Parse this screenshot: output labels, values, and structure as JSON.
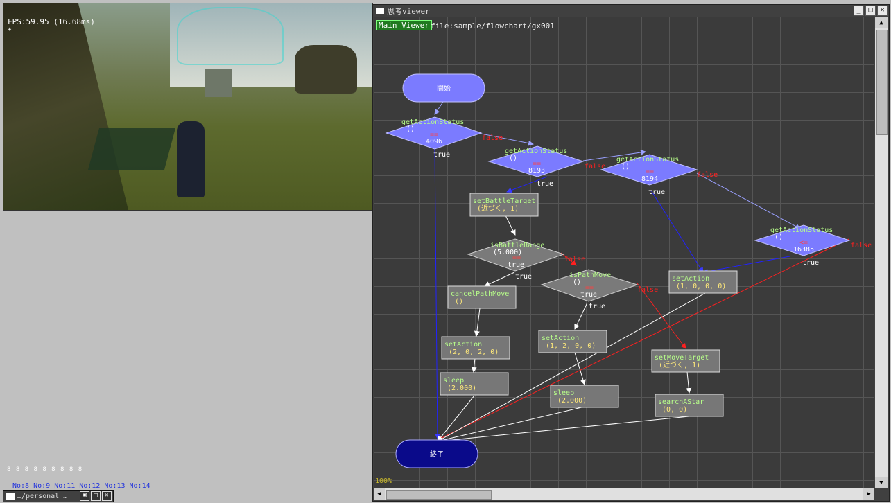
{
  "game": {
    "fps": "FPS:59.95 (16.68ms)",
    "fps_sub": "+"
  },
  "counters": [
    "No:8",
    "No:9",
    "No:11",
    "No:12",
    "No:13",
    "No:14"
  ],
  "dots": "8 8 8 8 8 8 8 8 8",
  "taskbar": {
    "title": "…/personal …"
  },
  "viewer": {
    "title": "思考viewer",
    "main_button": "Main Viewer",
    "file": "file:sample/flowchart/gx001",
    "zoom": "100%"
  },
  "flow": {
    "start": "開始",
    "end": "終了",
    "d1": [
      "getActionStatus",
      "()",
      "==",
      "4096"
    ],
    "d2": [
      "getActionStatus",
      "()",
      "==",
      "8193"
    ],
    "d3": [
      "getActionStatus",
      "()",
      "==",
      "8194"
    ],
    "d4": [
      "getActionStatus",
      "()",
      "<=",
      "16385"
    ],
    "d5": [
      "isBattleRange",
      "(5.000)",
      "==",
      "true"
    ],
    "d6": [
      "isPathMove",
      "()",
      "==",
      "true"
    ],
    "b1": [
      "setBattleTarget",
      "(近づく, 1)"
    ],
    "b2": [
      "cancelPathMove",
      "()"
    ],
    "b3": [
      "setAction",
      "(2, 0, 2, 0)"
    ],
    "b4": [
      "sleep",
      "(2.000)"
    ],
    "b5": [
      "setAction",
      "(1, 2, 0, 0)"
    ],
    "b6": [
      "sleep",
      "(2.000)"
    ],
    "b7": [
      "setAction",
      "(1, 0, 0, 0)"
    ],
    "b8": [
      "setMoveTarget",
      "(近づく, 1)"
    ],
    "b9": [
      "searchAStar",
      "(0, 0)"
    ],
    "true_label": "true",
    "false_label": "false"
  }
}
